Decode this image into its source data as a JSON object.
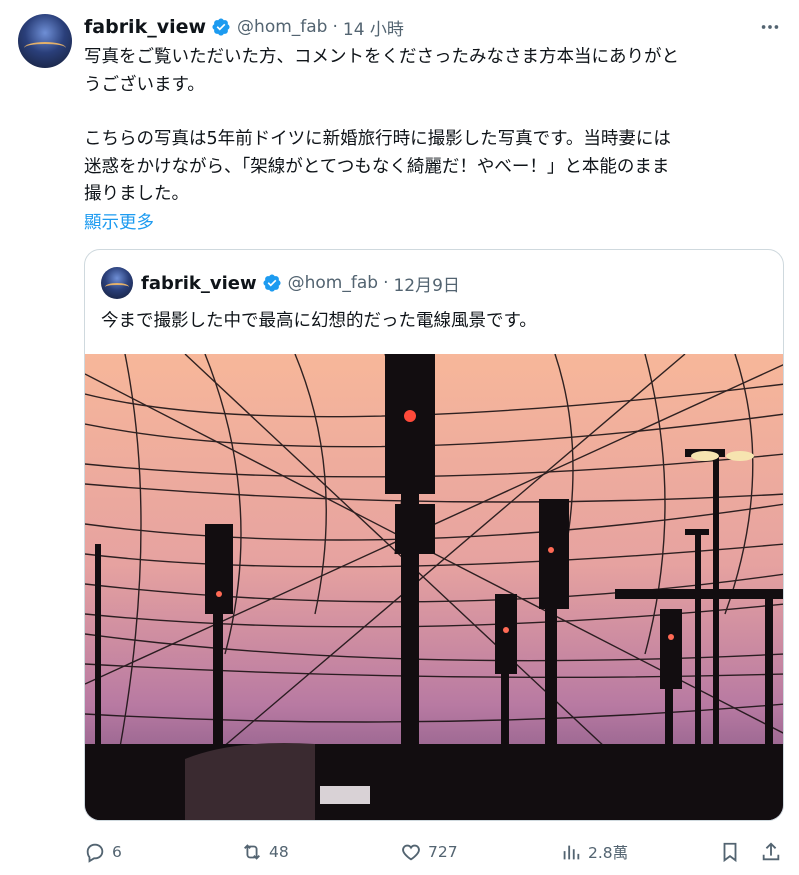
{
  "tweet": {
    "author_name": "fabrik_view",
    "handle": "@hom_fab",
    "separator": "·",
    "time": "14 小時",
    "lines": [
      "写真をご覧いただいた方、コメントをくださったみなさま方本当にありがと",
      "うございます。",
      "こちらの写真は5年前ドイツに新婚旅行時に撮影した写真です。当時妻には",
      "迷惑をかけながら、「架線がとてつもなく綺麗だ！やべー！」と本能のまま",
      "撮りました。"
    ],
    "show_more": "顯示更多"
  },
  "quoted": {
    "author_name": "fabrik_view",
    "handle": "@hom_fab",
    "separator": "·",
    "time": "12月9日",
    "text": "今まで撮影した中で最高に幻想的だった電線風景です。"
  },
  "actions": {
    "reply_count": "6",
    "retweet_count": "48",
    "like_count": "727",
    "views_count": "2.8萬"
  },
  "icons": {
    "verified": "verified-badge-icon",
    "more": "more-dots-icon",
    "reply": "reply-icon",
    "retweet": "retweet-icon",
    "like": "heart-icon",
    "views": "views-icon",
    "bookmark": "bookmark-icon",
    "share": "share-icon"
  },
  "colors": {
    "accent": "#1d9bf0",
    "muted": "#536471",
    "text": "#0f1419",
    "border": "#cfd9de"
  }
}
